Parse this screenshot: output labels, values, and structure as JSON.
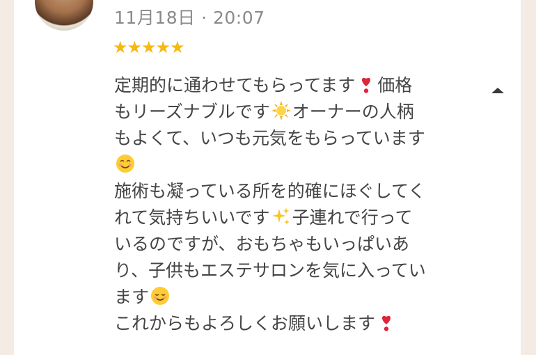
{
  "review": {
    "date": "11月18日 · 20:07",
    "stars": "★★★★★",
    "rating": 5,
    "lines": [
      {
        "text": "定期的に通わせてもらってます",
        "emoji": "heart-exclamation",
        "after": "価格"
      },
      {
        "text": "もリーズナブルです",
        "emoji": "sun",
        "after": "オーナーの人柄"
      },
      {
        "text": "もよくて、いつも元気をもらっています",
        "emoji": "",
        "after": ""
      },
      {
        "text": "",
        "emoji": "smiling-face",
        "after": ""
      },
      {
        "text": "施術も凝っている所を的確にほぐしてく",
        "emoji": "",
        "after": ""
      },
      {
        "text": "れて気持ちいいです",
        "emoji": "sparkles",
        "after": "子連れで行って"
      },
      {
        "text": "いるのですが、おもちゃもいっぱいあ",
        "emoji": "",
        "after": ""
      },
      {
        "text": "り、子供もエステサロンを気に入ってい",
        "emoji": "",
        "after": ""
      },
      {
        "text": "ます",
        "emoji": "relaxed-face",
        "after": ""
      },
      {
        "text": "これからもよろしくお願いします",
        "emoji": "heart-exclamation",
        "after": ""
      }
    ]
  },
  "colors": {
    "background": "#f4ebe5",
    "card": "#ffffff",
    "star": "#f6b910",
    "text": "#444444",
    "meta": "#8a8a8a"
  },
  "icons": {
    "collapse": "caret-up-icon",
    "avatar": "reviewer-avatar"
  }
}
